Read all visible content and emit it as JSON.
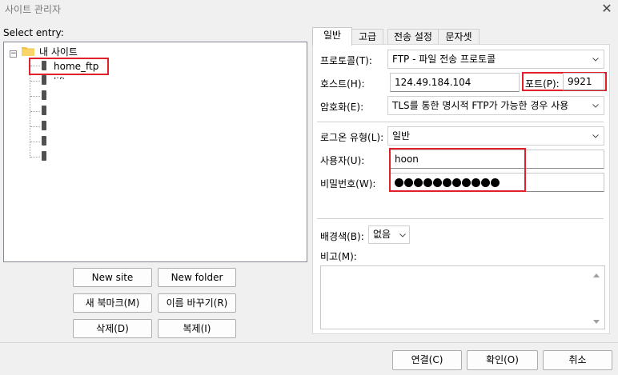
{
  "window": {
    "title": "사이트 관리자",
    "close_glyph": "✕"
  },
  "tree": {
    "label": "Select entry:",
    "toggle_glyph": "−",
    "root_label": "내 사이트",
    "items": [
      {
        "label": "home_ftp",
        "selected": true
      },
      {
        "label": "lift_page",
        "selected": false
      }
    ]
  },
  "left_buttons": {
    "new_site": "New site",
    "new_folder": "New folder",
    "new_bookmark": "새 북마크(M)",
    "rename": "이름 바꾸기(R)",
    "delete": "삭제(D)",
    "duplicate": "복제(I)"
  },
  "tabs": [
    {
      "label": "일반",
      "active": true
    },
    {
      "label": "고급",
      "active": false
    },
    {
      "label": "전송 설정",
      "active": false
    },
    {
      "label": "문자셋",
      "active": false
    }
  ],
  "general": {
    "protocol": {
      "label": "프로토콜(T):",
      "value": "FTP - 파일 전송 프로토콜"
    },
    "host": {
      "label": "호스트(H):",
      "value": "124.49.184.104"
    },
    "port": {
      "label": "포트(P):",
      "value": "9921"
    },
    "encryption": {
      "label": "암호화(E):",
      "value": "TLS를 통한 명시적 FTP가 가능한 경우 사용"
    },
    "logon_type": {
      "label": "로그온 유형(L):",
      "value": "일반"
    },
    "user": {
      "label": "사용자(U):",
      "value": "hoon"
    },
    "password": {
      "label": "비밀번호(W):",
      "masked_length": 11
    },
    "background_color": {
      "label": "배경색(B):",
      "value": "없음"
    },
    "comments": {
      "label": "비고(M):",
      "value": ""
    }
  },
  "footer": {
    "connect": "연결(C)",
    "ok": "확인(O)",
    "cancel": "취소"
  },
  "colors": {
    "highlight_red": "#e0202a",
    "folder_yellow": "#f3c443"
  },
  "icons": {
    "close": "close-icon",
    "folder": "folder-icon",
    "server": "server-icon",
    "dropdown": "chevron-down-icon"
  }
}
